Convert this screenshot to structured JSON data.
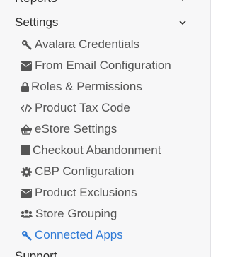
{
  "sidebar": {
    "top_cut_section_label": "Reports",
    "settings_header": "Settings",
    "items": [
      {
        "label": "Avalara Credentials",
        "icon": "wrench-icon"
      },
      {
        "label": "From Email Configuration",
        "icon": "envelope-icon"
      },
      {
        "label": "Roles & Permissions",
        "icon": "lock-icon"
      },
      {
        "label": "Product Tax Code",
        "icon": "code-icon"
      },
      {
        "label": "eStore Settings",
        "icon": "basket-icon"
      },
      {
        "label": "Checkout Abandonment",
        "icon": "square-icon"
      },
      {
        "label": "CBP Configuration",
        "icon": "gear-icon"
      },
      {
        "label": "Product Exclusions",
        "icon": "envelope-icon"
      },
      {
        "label": "Store Grouping",
        "icon": "users-icon"
      },
      {
        "label": "Connected Apps",
        "icon": "wrench-icon",
        "active": true
      }
    ],
    "next_section_label": "Support"
  },
  "colors": {
    "active": "#2f7ad6",
    "text": "#555555",
    "header": "#2b2b2b",
    "background": "#f7f7f8"
  }
}
